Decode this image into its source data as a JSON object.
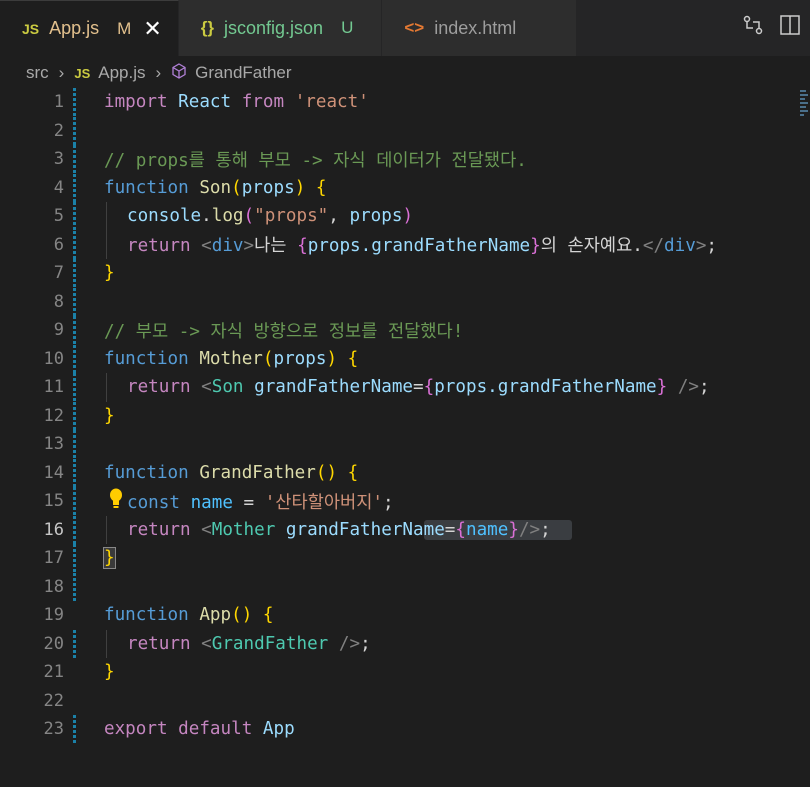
{
  "tabs": [
    {
      "icon": "JS",
      "name": "App.js",
      "status": "M",
      "close": "✕"
    },
    {
      "icon": "{}",
      "name": "jsconfig.json",
      "status": "U"
    },
    {
      "icon": "<>",
      "name": "index.html"
    }
  ],
  "breadcrumb": {
    "folder": "src",
    "file_badge": "JS",
    "file": "App.js",
    "symbol": "GrandFather"
  },
  "editor": {
    "line_numbers": [
      "1",
      "2",
      "3",
      "4",
      "5",
      "6",
      "7",
      "8",
      "9",
      "10",
      "11",
      "12",
      "13",
      "14",
      "15",
      "16",
      "17",
      "18",
      "19",
      "20",
      "21",
      "22",
      "23"
    ],
    "l1": {
      "kw": "import",
      "name": "React",
      "from": "from",
      "str": "'react'"
    },
    "l3": {
      "comment": "// props를 통해 부모 -> 자식 데이터가 전달됐다."
    },
    "l4": {
      "kw": "function",
      "fn": "Son",
      "p1": "(",
      "param": "props",
      "p2": ")",
      "b": "{"
    },
    "l5": {
      "obj": "console",
      "dot": ".",
      "fn": "log",
      "p1": "(",
      "str": "\"props\"",
      "comma": ", ",
      "param": "props",
      "p2": ")"
    },
    "l6": {
      "kw": "return",
      "lt": "<",
      "tag": "div",
      "gt": ">",
      "text1": "나는 ",
      "b1": "{",
      "expr": "props.grandFatherName",
      "b2": "}",
      "text2": "의 손자예요.",
      "close_lt": "</",
      "close_tag": "div",
      "close_gt": ">",
      "semi": ";"
    },
    "l7": {
      "b": "}"
    },
    "l9": {
      "comment": "// 부모 -> 자식 방향으로 정보를 전달했다!"
    },
    "l10": {
      "kw": "function",
      "fn": "Mother",
      "p1": "(",
      "param": "props",
      "p2": ")",
      "b": "{"
    },
    "l11": {
      "kw": "return",
      "lt": "<",
      "tag": "Son",
      "attr": "grandFatherName",
      "eq": "=",
      "b1": "{",
      "expr": "props.grandFatherName",
      "b2": "}",
      "end": " />",
      "semi": ";"
    },
    "l12": {
      "b": "}"
    },
    "l14": {
      "kw": "function",
      "fn": "GrandFather",
      "parens": "()",
      "b": "{"
    },
    "l15": {
      "kw": "const",
      "name": "name",
      "eq": " = ",
      "str": "'산타할아버지'",
      "semi": ";"
    },
    "l16": {
      "kw": "return",
      "lt": "<",
      "tag": "Mother",
      "attr_a": "grandFatherNa",
      "attr_b": "me",
      "eq": "=",
      "b1": "{",
      "expr": "name",
      "b2": "}",
      "end": "/>",
      "semi": ";"
    },
    "l17": {
      "b": "}"
    },
    "l19": {
      "kw": "function",
      "fn": "App",
      "parens": "()",
      "b": "{"
    },
    "l20": {
      "kw": "return",
      "lt": "<",
      "tag": "GrandFather",
      "end": " />",
      "semi": ";"
    },
    "l21": {
      "b": "}"
    },
    "l23": {
      "kw1": "export",
      "kw2": "default",
      "name": "App"
    }
  },
  "icons": {
    "bulb": "lightbulb-icon",
    "compare": "open-changes-icon",
    "split": "split-editor-icon"
  }
}
